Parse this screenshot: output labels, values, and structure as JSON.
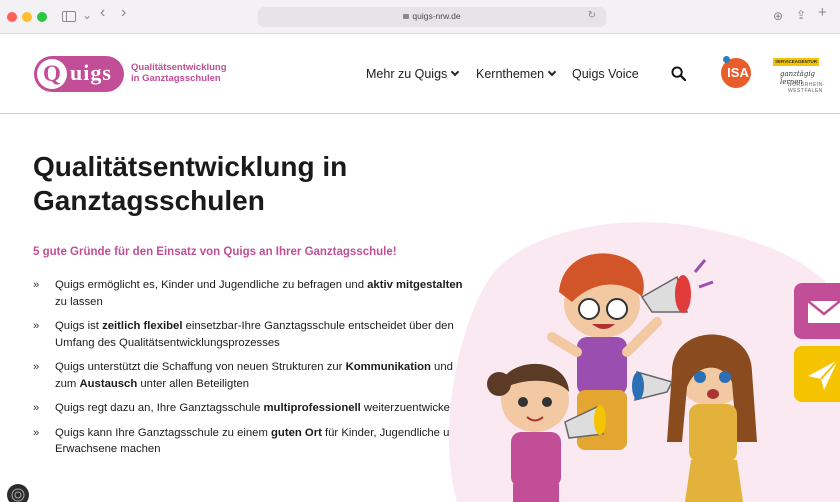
{
  "browser": {
    "url": "quigs-nrw.de",
    "icons": [
      "sidebar-icon",
      "chevron-down-icon",
      "back-icon",
      "forward-icon",
      "lock-icon",
      "reload-icon",
      "download-icon",
      "share-icon",
      "new-tab-icon"
    ],
    "glyphs": {
      "back": "‹",
      "forward": "›",
      "chevron": "⌄",
      "reload": "↻",
      "download": "⊕",
      "share": "⇪",
      "new_tab": "+"
    }
  },
  "header": {
    "logo": {
      "q": "Q",
      "rest": "uigs"
    },
    "tagline_1": "Qualitätsentwicklung",
    "tagline_2": "in Ganztagsschulen",
    "nav": [
      {
        "label": "Mehr zu Quigs",
        "has_dropdown": true
      },
      {
        "label": "Kernthemen",
        "has_dropdown": true
      },
      {
        "label": "Quigs Voice",
        "has_dropdown": false
      }
    ],
    "isa_logo": "ISA",
    "servicestelle": {
      "badge": "SERVICEAGENTUR",
      "script": "ganztägig lernen",
      "sub": "NORDRHEIN-WESTFALEN"
    }
  },
  "main": {
    "title": "Qualitätsentwicklung in Ganztagsschulen",
    "subheading": "5 gute Gründe für den Einsatz von Quigs an Ihrer Ganztagsschule!",
    "bullet": "»",
    "reasons": [
      {
        "a": "Quigs ermöglicht es, Kinder und Jugendliche zu befragen und ",
        "b": "aktiv mitgestalten",
        "c": " zu lassen",
        "d": "",
        "e": ""
      },
      {
        "a": "Quigs ist ",
        "b": "zeitlich flexibel",
        "c": " einsetzbar-Ihre Ganztagsschule entscheidet über den Umfang des Qualitätsentwicklungsprozesses",
        "d": "",
        "e": ""
      },
      {
        "a": "Quigs unterstützt die Schaffung von neuen Strukturen zur ",
        "b": "Kommunikation",
        "c": " und zum ",
        "d": "Austausch",
        "e": " unter allen Beteiligten"
      },
      {
        "a": "Quigs regt dazu an, Ihre Ganztagsschule ",
        "b": "multiprofessionell",
        "c": " weiterzuentwickeln",
        "d": "",
        "e": ""
      },
      {
        "a": "Quigs kann Ihre Ganztagsschule zu einem ",
        "b": "guten Ort",
        "c": " für Kinder, Jugendliche und Erwachsene machen",
        "d": "",
        "e": ""
      }
    ]
  },
  "colors": {
    "brand_pink": "#c14e96",
    "brand_yellow": "#f4c400",
    "isa_orange": "#e85d2a"
  }
}
